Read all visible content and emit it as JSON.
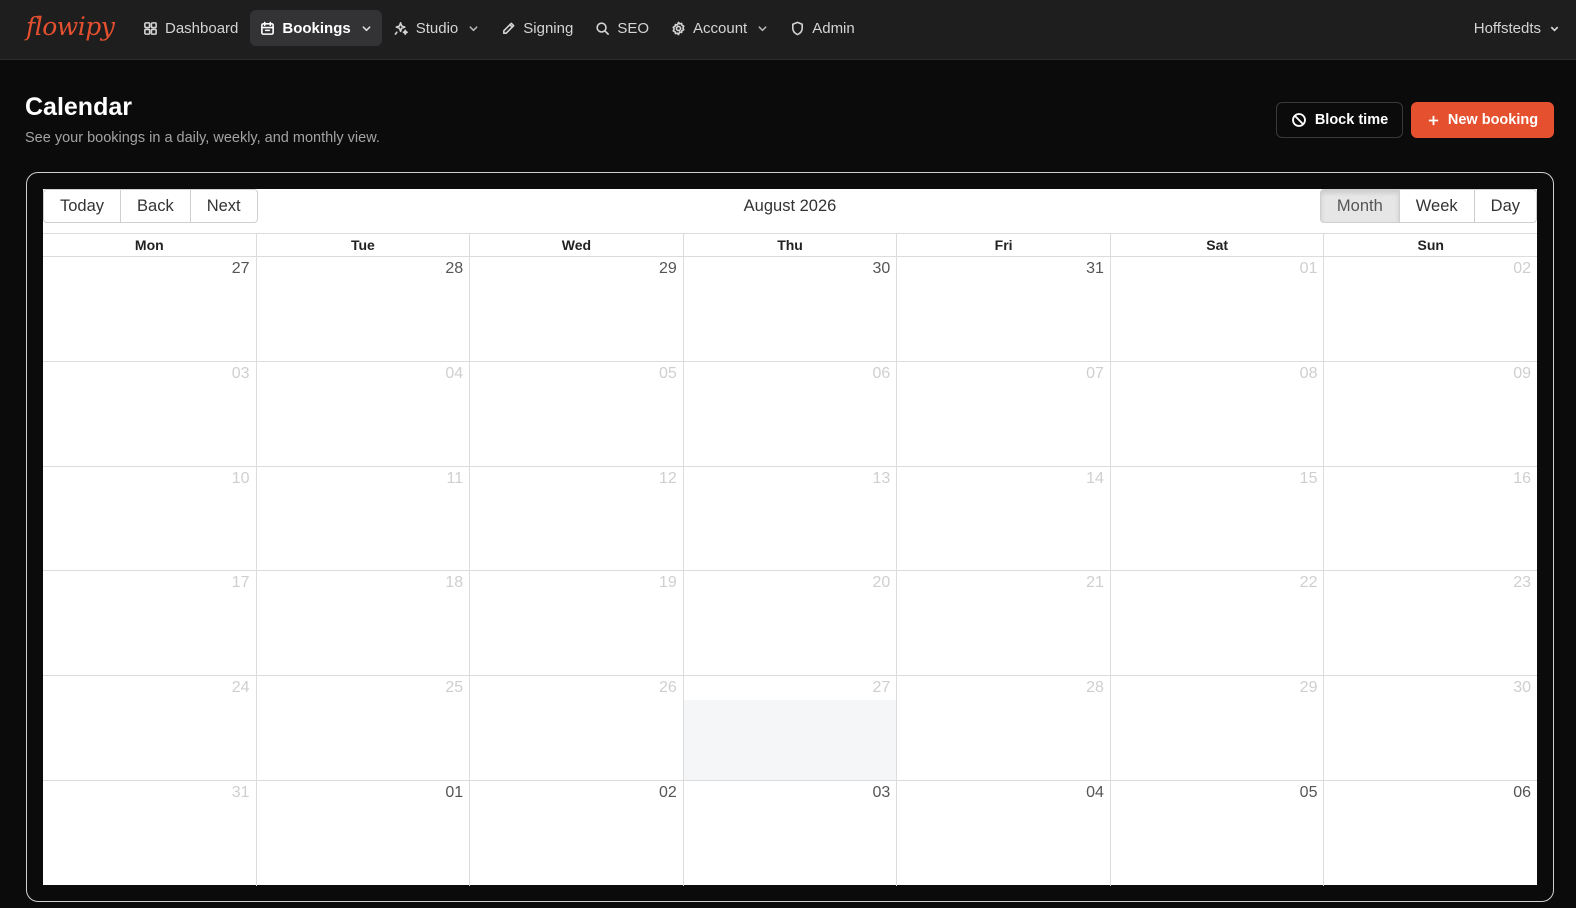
{
  "brand": {
    "logo_text": "flowipy",
    "accent": "#e5502f"
  },
  "nav": {
    "items": [
      {
        "label": "Dashboard",
        "icon": "grid-icon"
      },
      {
        "label": "Bookings",
        "icon": "calendar-icon",
        "active": true,
        "dropdown": true
      },
      {
        "label": "Studio",
        "icon": "sparkle-icon",
        "dropdown": true
      },
      {
        "label": "Signing",
        "icon": "pen-icon"
      },
      {
        "label": "SEO",
        "icon": "search-icon"
      },
      {
        "label": "Account",
        "icon": "gear-icon",
        "dropdown": true
      },
      {
        "label": "Admin",
        "icon": "shield-icon"
      }
    ],
    "user": "Hoffstedts"
  },
  "page": {
    "title": "Calendar",
    "subtitle": "See your bookings in a daily, weekly, and monthly view.",
    "block_time": "Block time",
    "new_booking": "New booking"
  },
  "calendar": {
    "nav_buttons": [
      "Today",
      "Back",
      "Next"
    ],
    "label": "August 2026",
    "views": [
      "Month",
      "Week",
      "Day"
    ],
    "active_view": "Month",
    "weekdays": [
      "Mon",
      "Tue",
      "Wed",
      "Thu",
      "Fri",
      "Sat",
      "Sun"
    ],
    "weeks": [
      [
        "27",
        "28",
        "29",
        "30",
        "31",
        "01",
        "02"
      ],
      [
        "03",
        "04",
        "05",
        "06",
        "07",
        "08",
        "09"
      ],
      [
        "10",
        "11",
        "12",
        "13",
        "14",
        "15",
        "16"
      ],
      [
        "17",
        "18",
        "19",
        "20",
        "21",
        "22",
        "23"
      ],
      [
        "24",
        "25",
        "26",
        "27",
        "28",
        "29",
        "30"
      ],
      [
        "31",
        "01",
        "02",
        "03",
        "04",
        "05",
        "06"
      ]
    ]
  }
}
